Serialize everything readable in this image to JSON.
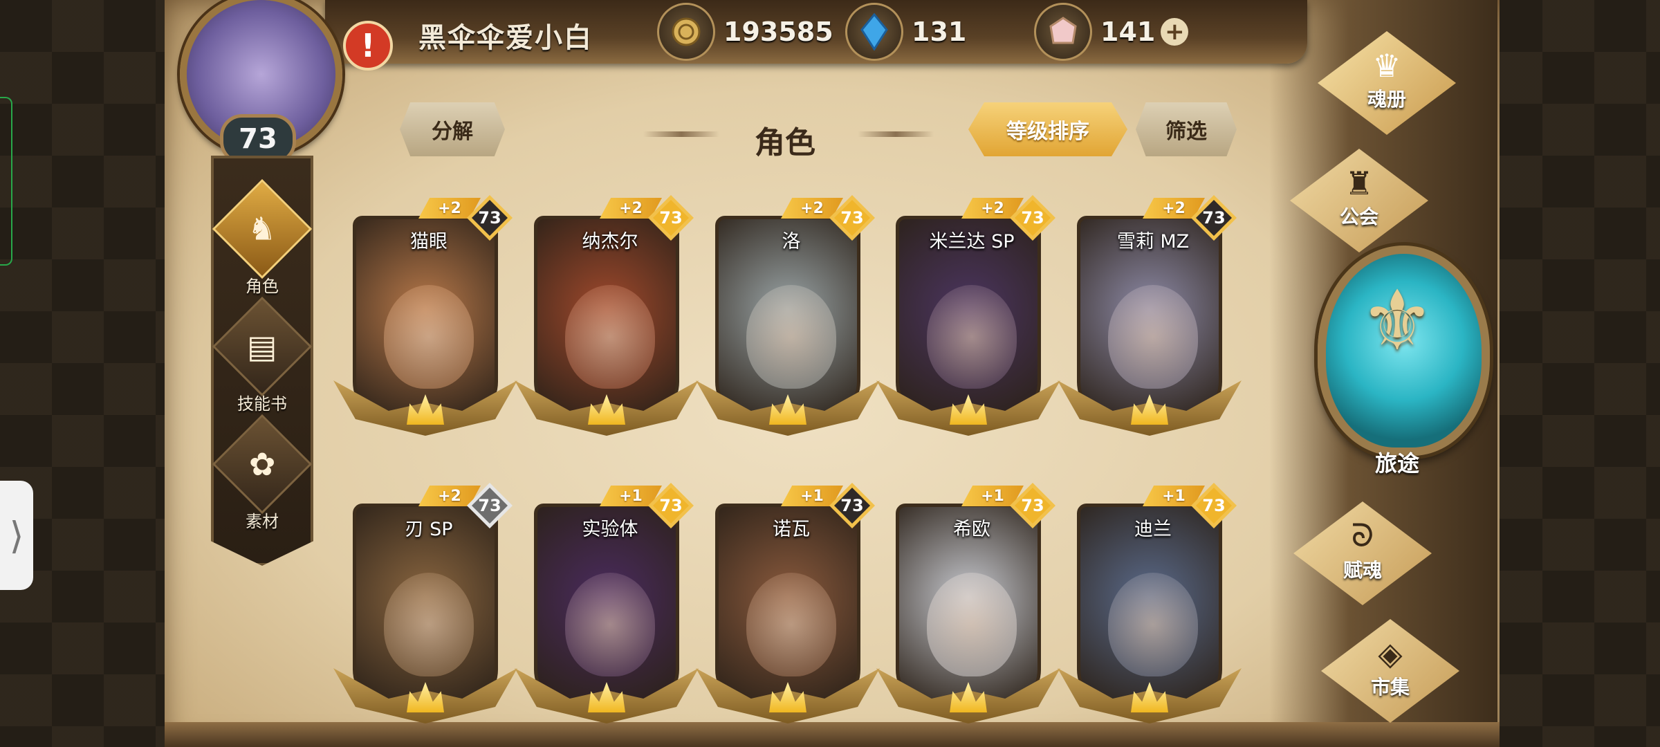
{
  "header": {
    "player_name": "黑伞伞爱小白",
    "avatar_level": "73",
    "resources": [
      {
        "icon": "gold-coin-icon",
        "value": "193585"
      },
      {
        "icon": "blue-crystal-icon",
        "value": "131"
      },
      {
        "icon": "pink-gem-icon",
        "value": "141"
      }
    ],
    "plus_symbol": "+",
    "alert_symbol": "!"
  },
  "toolbar": {
    "decompose_label": "分解",
    "page_title": "角色",
    "sort_label": "等级排序",
    "filter_label": "筛选"
  },
  "side_menu": [
    {
      "label": "角色",
      "icon": "character-crest-icon",
      "glyph": "♞",
      "active": true
    },
    {
      "label": "技能书",
      "icon": "skill-book-icon",
      "glyph": "▤",
      "active": false
    },
    {
      "label": "素材",
      "icon": "material-icon",
      "glyph": "✿",
      "active": false
    }
  ],
  "characters": [
    {
      "name": "猫眼",
      "plus": "+2",
      "level": "73",
      "badge": "dark",
      "color": "#b8794a"
    },
    {
      "name": "纳杰尔",
      "plus": "+2",
      "level": "73",
      "badge": "gold",
      "color": "#a0492c"
    },
    {
      "name": "洛",
      "plus": "+2",
      "level": "73",
      "badge": "gold",
      "color": "#9aa4a6"
    },
    {
      "name": "米兰达 SP",
      "plus": "+2",
      "level": "73",
      "badge": "gold",
      "color": "#4b3560"
    },
    {
      "name": "雪莉 MZ",
      "plus": "+2",
      "level": "73",
      "badge": "dark",
      "color": "#8d8aa6"
    },
    {
      "name": "刃 SP",
      "plus": "+2",
      "level": "73",
      "badge": "silver",
      "color": "#8a6640"
    },
    {
      "name": "实验体",
      "plus": "+1",
      "level": "73",
      "badge": "gold",
      "color": "#4a2b5e"
    },
    {
      "name": "诺瓦",
      "plus": "+1",
      "level": "73",
      "badge": "dark",
      "color": "#8a5a3d"
    },
    {
      "name": "希欧",
      "plus": "+1",
      "level": "73",
      "badge": "gold",
      "color": "#c7c9cf"
    },
    {
      "name": "迪兰",
      "plus": "+1",
      "level": "73",
      "badge": "gold",
      "color": "#5a6a8a"
    }
  ],
  "right_nav": {
    "soul_book": {
      "label": "魂册",
      "icon": "soul-book-crest-icon",
      "glyph": "♛"
    },
    "guild": {
      "label": "公会",
      "icon": "guild-dragon-icon",
      "glyph": "♜"
    },
    "journey": {
      "label": "旅途",
      "icon": "journey-orb-icon",
      "glyph": "⚜"
    },
    "soul_gift": {
      "label": "赋魂",
      "icon": "soul-flame-icon",
      "glyph": "ᘐ"
    },
    "market": {
      "label": "市集",
      "icon": "market-gem-icon",
      "glyph": "◈"
    }
  },
  "edge": {
    "drawer_glyph": "⟩"
  }
}
